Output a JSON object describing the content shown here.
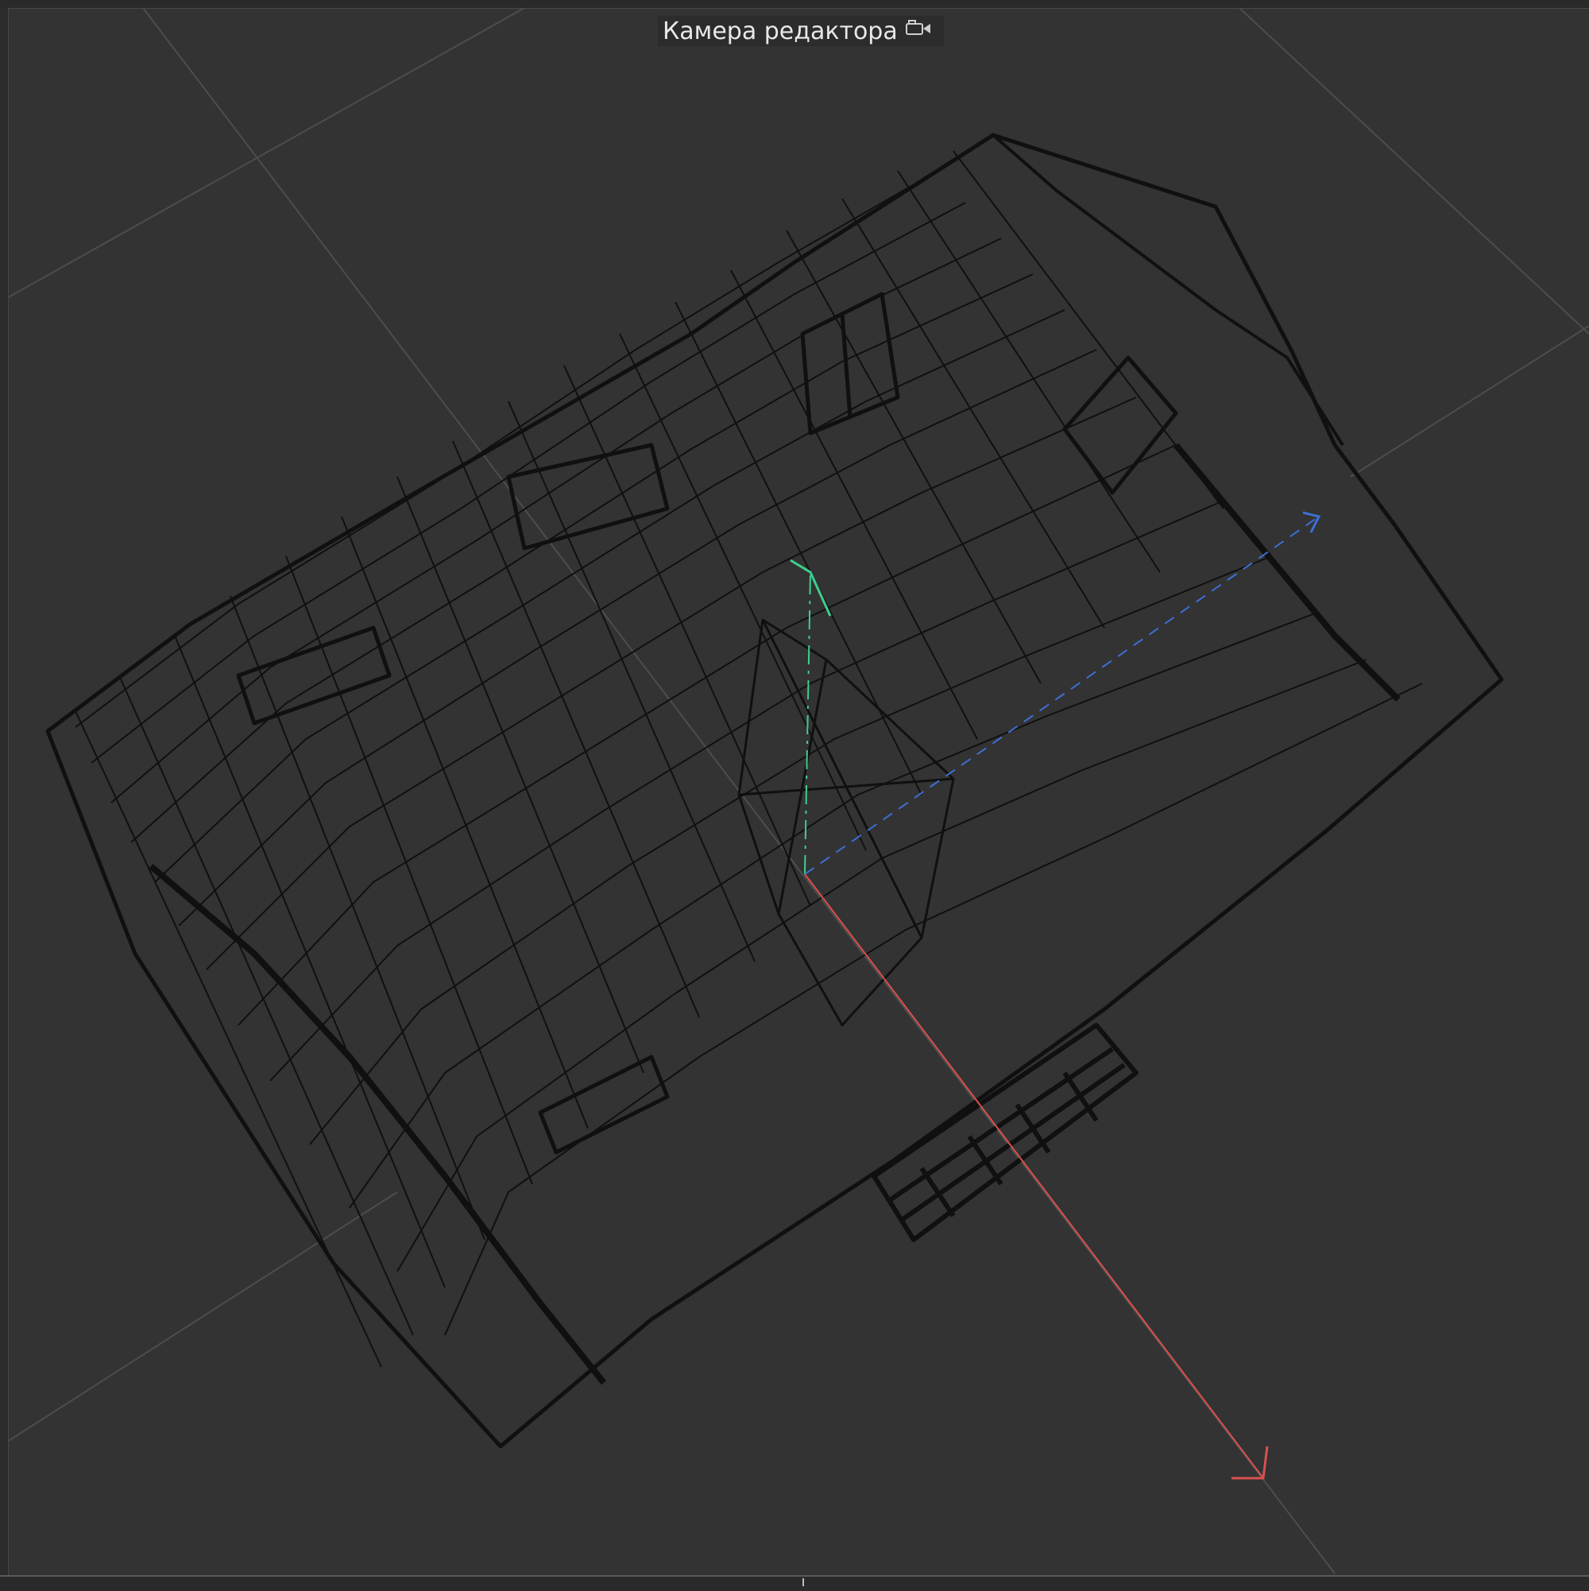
{
  "viewport": {
    "camera_label": "Камера редактора",
    "camera_icon": "camera-icon",
    "background_color": "#333333",
    "grid_color": "#4a4a4a",
    "wireframe_color": "#111111",
    "axis_colors": {
      "x": "#d9504f",
      "y": "#3ecf8e",
      "z": "#3d6fd6"
    }
  }
}
